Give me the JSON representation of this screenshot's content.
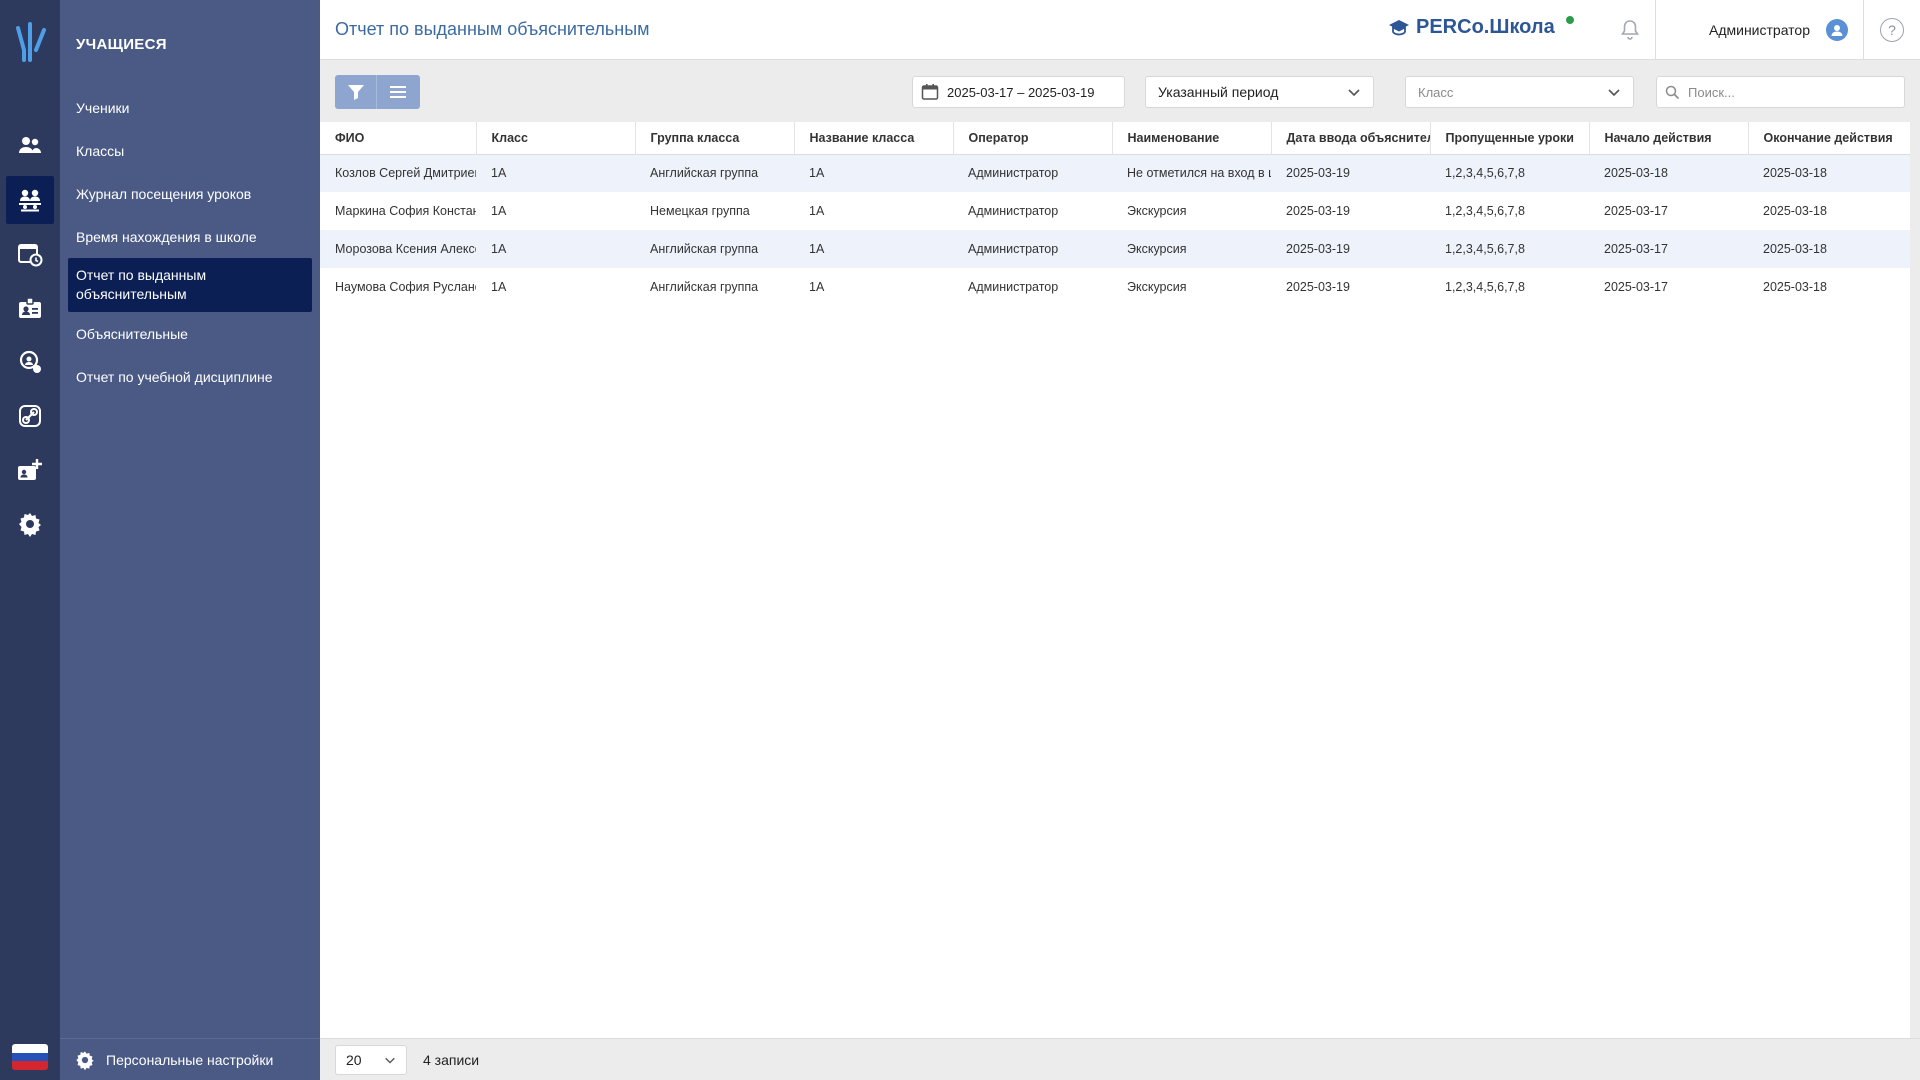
{
  "app": {
    "title": "Отчет по выданным объяснительным",
    "brand": "PERCo.Школа",
    "user": "Администратор",
    "help": "?"
  },
  "rail": {
    "items": [
      "students-icon",
      "students-group-icon",
      "calendar-clock-icon",
      "id-card-icon",
      "guard-icon",
      "link-icon",
      "add-card-icon",
      "settings-icon"
    ],
    "active": "students-group-icon"
  },
  "sidebar": {
    "section_title": "УЧАЩИЕСЯ",
    "items": [
      {
        "label": "Ученики"
      },
      {
        "label": "Классы"
      },
      {
        "label": "Журнал посещения уроков"
      },
      {
        "label": "Время нахождения в школе"
      },
      {
        "label": "Отчет по выданным объяснительным",
        "active": true
      },
      {
        "label": "Объяснительные"
      },
      {
        "label": "Отчет по учебной дисциплине"
      }
    ],
    "footer_label": "Персональные настройки"
  },
  "toolbar": {
    "date_range": "2025-03-17 – 2025-03-19",
    "period": "Указанный период",
    "class_placeholder": "Класс",
    "search_placeholder": "Поиск..."
  },
  "table": {
    "columns": [
      "ФИО",
      "Класс",
      "Группа класса",
      "Название класса",
      "Оператор",
      "Наименование",
      "Дата ввода объяснительной",
      "Пропущенные уроки",
      "Начало действия",
      "Окончание действия"
    ],
    "rows": [
      [
        "Козлов Сергей Дмитриевич",
        "1А",
        "Английская группа",
        "1А",
        "Администратор",
        "Не отметился на вход в школу",
        "2025-03-19",
        "1,2,3,4,5,6,7,8",
        "2025-03-18",
        "2025-03-18"
      ],
      [
        "Маркина София Константиновна",
        "1А",
        "Немецкая группа",
        "1А",
        "Администратор",
        "Экскурсия",
        "2025-03-19",
        "1,2,3,4,5,6,7,8",
        "2025-03-17",
        "2025-03-18"
      ],
      [
        "Морозова Ксения Алексеевна",
        "1А",
        "Английская группа",
        "1А",
        "Администратор",
        "Экскурсия",
        "2025-03-19",
        "1,2,3,4,5,6,7,8",
        "2025-03-17",
        "2025-03-18"
      ],
      [
        "Наумова София Руслановна",
        "1А",
        "Английская группа",
        "1А",
        "Администратор",
        "Экскурсия",
        "2025-03-19",
        "1,2,3,4,5,6,7,8",
        "2025-03-17",
        "2025-03-18"
      ]
    ]
  },
  "footer": {
    "page_size": "20",
    "record_count": "4 записи"
  },
  "colors": {
    "rail_bg": "#2d3a5e",
    "sidebar_bg": "#4a5a85",
    "active_bg": "#0b1f55",
    "title": "#3c6aa3",
    "brand": "#2d5696",
    "status_dot": "#2e9b4c"
  }
}
